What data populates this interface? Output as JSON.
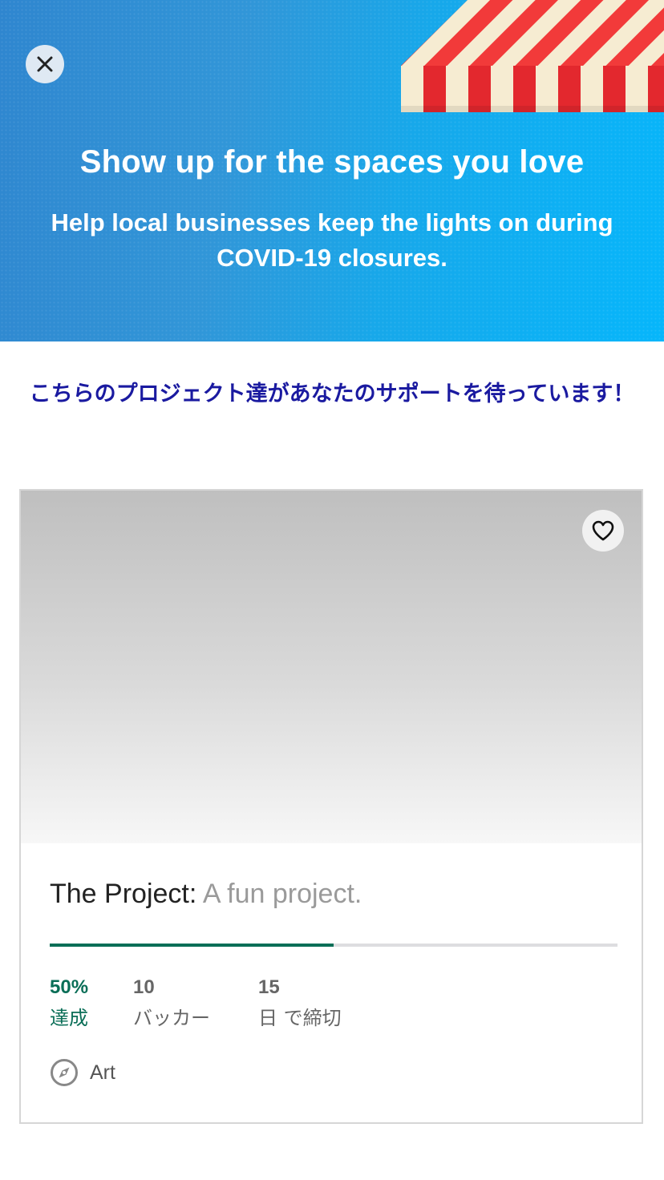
{
  "banner": {
    "title": "Show up for the spaces you love",
    "subtitle": "Help local businesses keep the lights on during COVID-19 closures.",
    "close_icon": "close-icon"
  },
  "section": {
    "heading": "こちらのプロジェクト達があなたのサポートを待っています！"
  },
  "project": {
    "name": "The Project:",
    "blurb": "A fun project.",
    "progress_percent": 50,
    "stats": {
      "funded_value": "50%",
      "funded_label": "達成",
      "backers_value": "10",
      "backers_label": "バッカー",
      "days_value": "15",
      "days_label": "日 で締切"
    },
    "category": "Art",
    "category_icon": "compass-icon",
    "favorite_icon": "heart-icon"
  },
  "colors": {
    "accent_green": "#0a6e57",
    "heading_navy": "#1a1aa0",
    "banner_blue": "#2f86cf"
  }
}
